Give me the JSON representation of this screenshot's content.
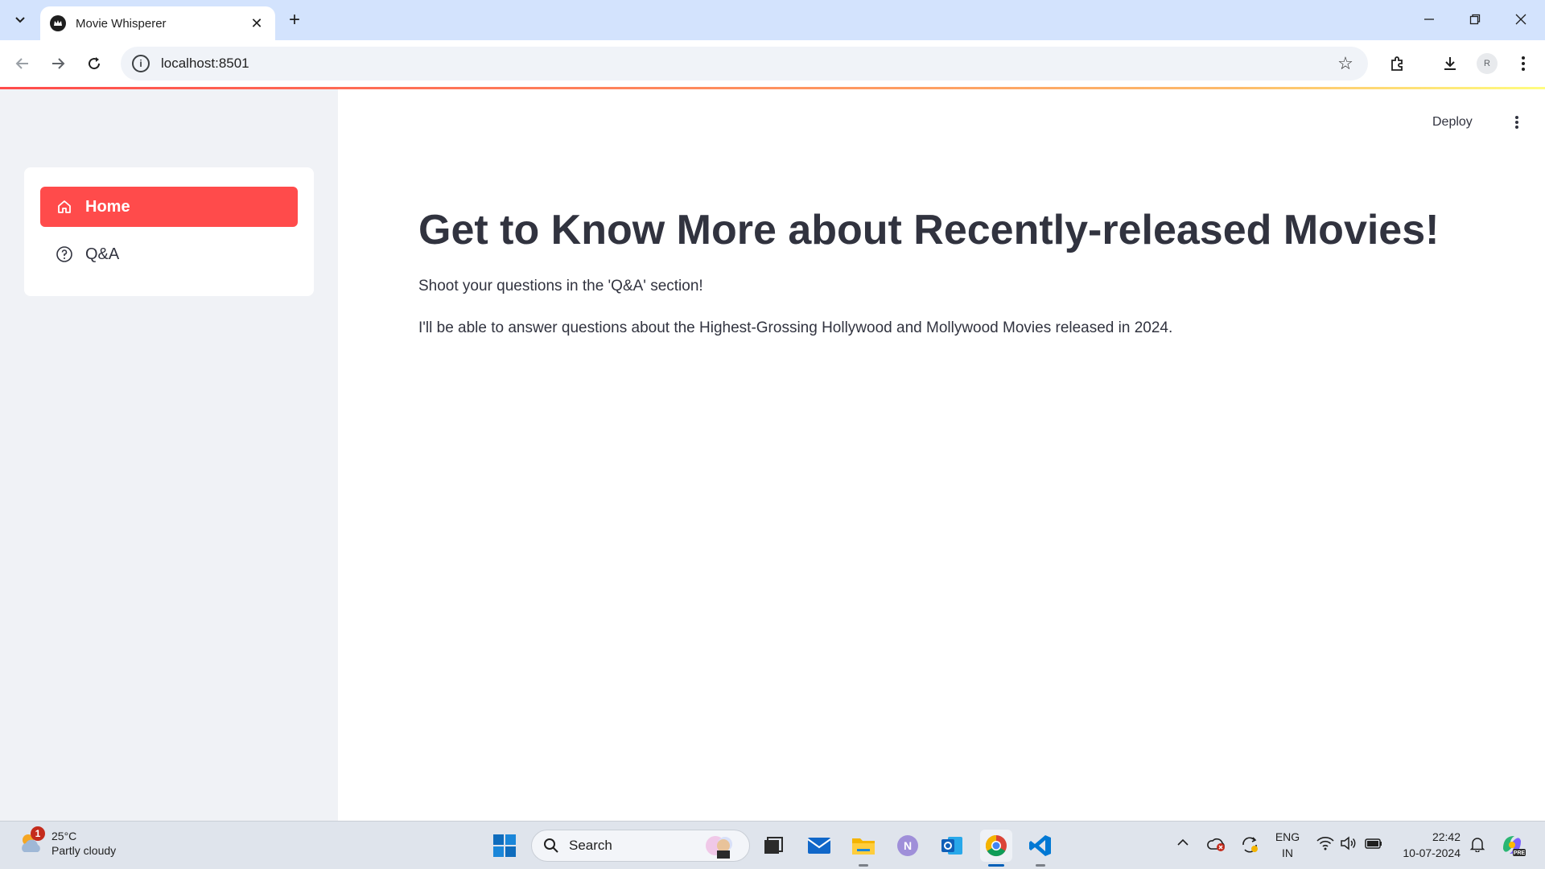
{
  "browser": {
    "tab_title": "Movie Whisperer",
    "url": "localhost:8501",
    "profile_initial": "R"
  },
  "header": {
    "deploy_label": "Deploy"
  },
  "sidebar": {
    "items": [
      {
        "label": "Home",
        "icon": "home-icon",
        "active": true
      },
      {
        "label": "Q&A",
        "icon": "help-circle-icon",
        "active": false
      }
    ]
  },
  "main": {
    "title": "Get to Know More about Recently-released Movies!",
    "paragraphs": [
      "Shoot your questions in the 'Q&A' section!",
      "I'll be able to answer questions about the Highest-Grossing Hollywood and Mollywood Movies released in 2024."
    ]
  },
  "taskbar": {
    "weather_temp": "25°C",
    "weather_desc": "Partly cloudy",
    "weather_badge": "1",
    "search_label": "Search",
    "lang_top": "ENG",
    "lang_bottom": "IN",
    "time": "22:42",
    "date": "10-07-2024"
  },
  "colors": {
    "accent": "#ff4b4b",
    "sidebar_bg": "#f0f2f6",
    "text": "#31333f",
    "tab_strip": "#d3e3fd"
  }
}
